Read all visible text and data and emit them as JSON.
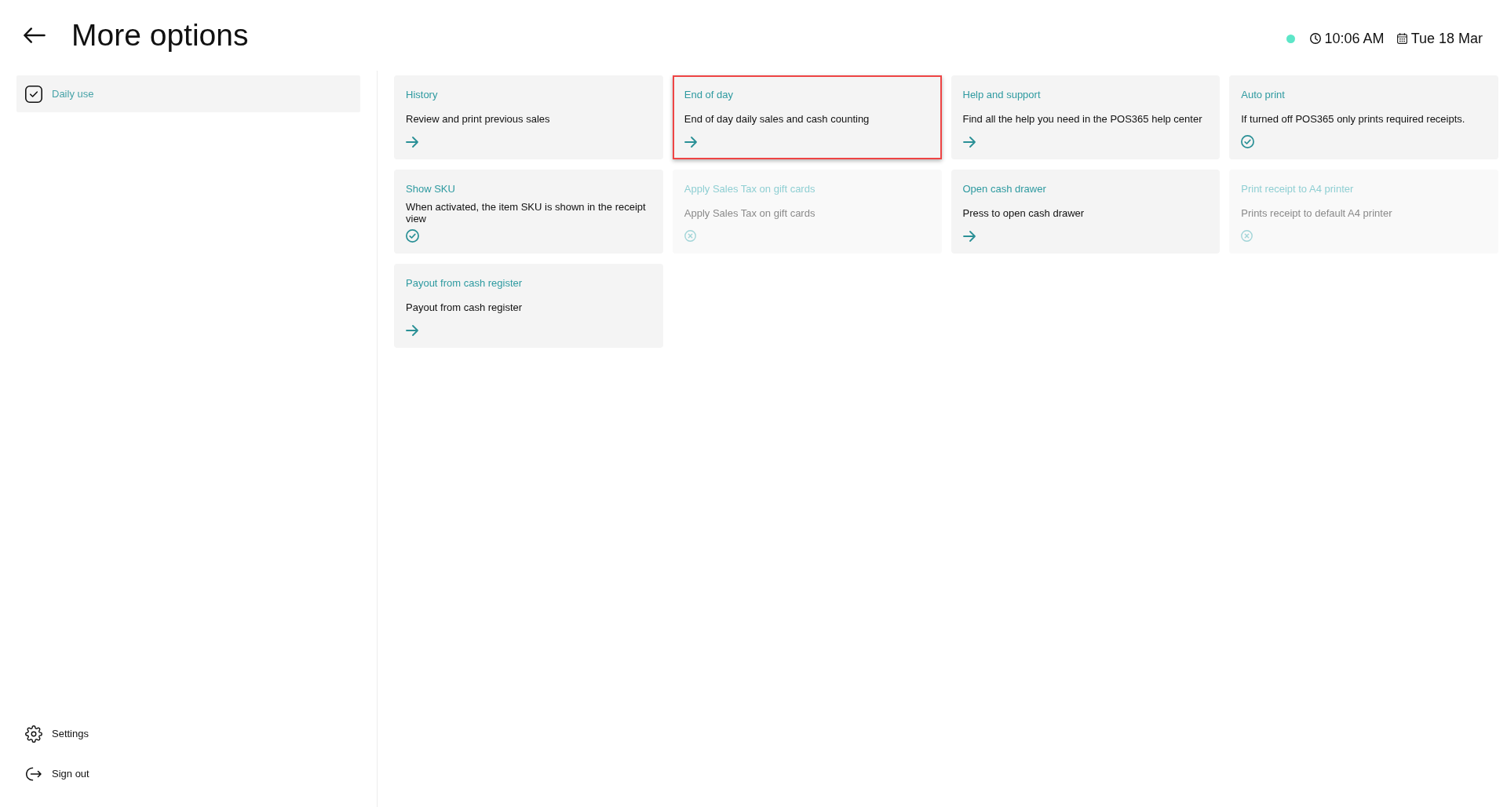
{
  "header": {
    "title": "More options",
    "status": {
      "connected": true
    },
    "time": "10:06 AM",
    "date": "Tue 18 Mar"
  },
  "sidebar": {
    "items": [
      {
        "label": "Daily use",
        "selected": true
      }
    ],
    "footer_items": [
      {
        "kind": "settings",
        "label": "Settings"
      },
      {
        "kind": "sign-out",
        "label": "Sign out"
      }
    ]
  },
  "cards": [
    {
      "title": "History",
      "description": "Review and print previous sales",
      "kind": "link",
      "highlighted": false
    },
    {
      "title": "End of day",
      "description": "End of day daily sales and cash counting",
      "kind": "link",
      "highlighted": true
    },
    {
      "title": "Help and support",
      "description": "Find all the help you need in the POS365 help center",
      "kind": "link",
      "highlighted": false
    },
    {
      "title": "Auto print",
      "description": "If turned off POS365 only prints required receipts.",
      "kind": "toggle",
      "on": true,
      "highlighted": false
    },
    {
      "title": "Show SKU",
      "description": "When activated, the item SKU is shown in the receipt view",
      "kind": "toggle",
      "on": true,
      "highlighted": false
    },
    {
      "title": "Apply Sales Tax on gift cards",
      "description": "Apply Sales Tax on gift cards",
      "kind": "toggle",
      "on": false,
      "highlighted": false
    },
    {
      "title": "Open cash drawer",
      "description": "Press to open cash drawer",
      "kind": "link",
      "highlighted": false
    },
    {
      "title": "Print receipt to A4 printer",
      "description": "Prints receipt to default A4 printer",
      "kind": "toggle",
      "on": false,
      "highlighted": false
    },
    {
      "title": "Payout from cash register",
      "description": "Payout from cash register",
      "kind": "link",
      "highlighted": false
    }
  ]
}
